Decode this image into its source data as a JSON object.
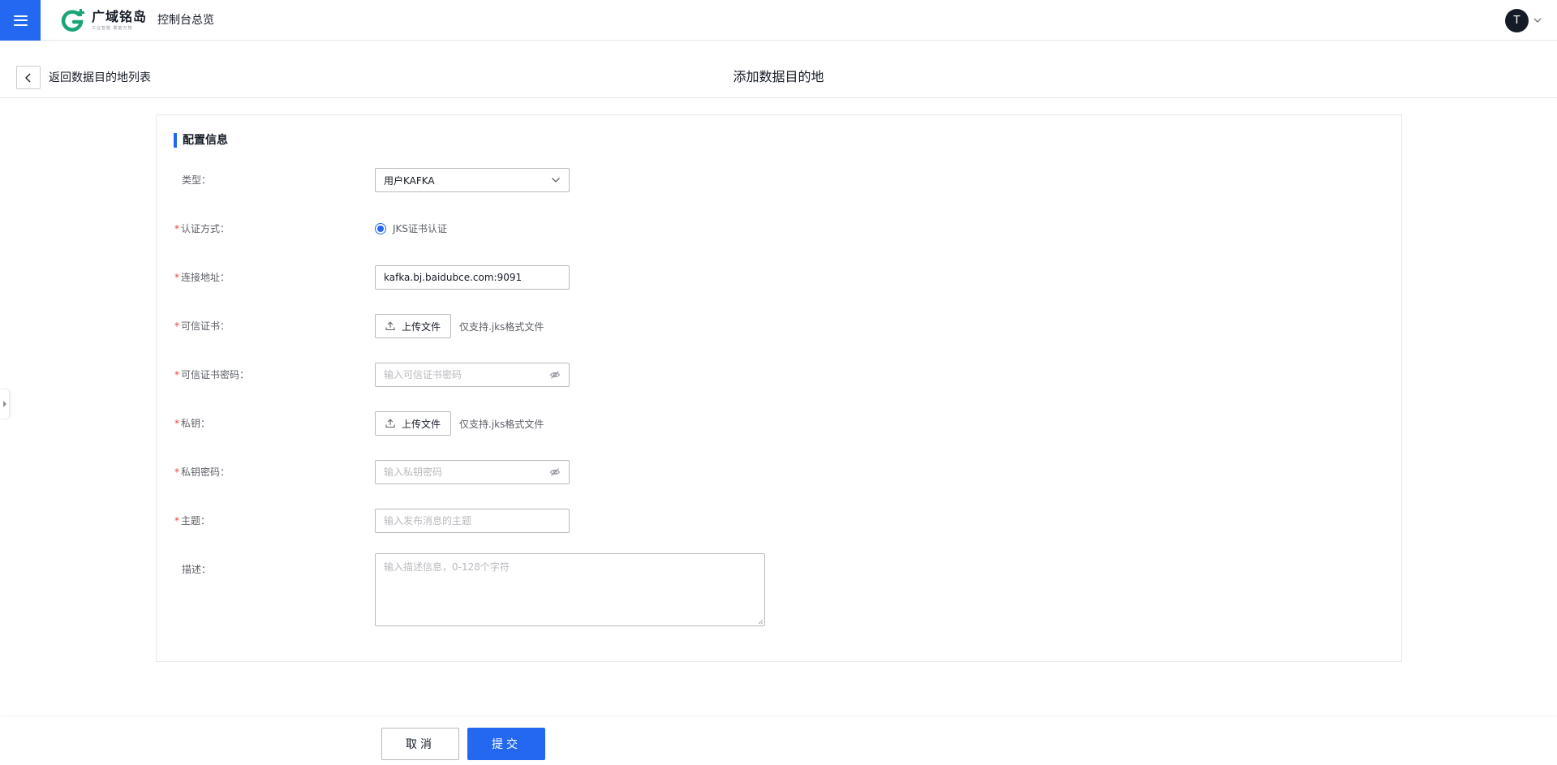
{
  "header": {
    "brand_name": "广域铭岛",
    "brand_slogan": "工业智能 赋能万物",
    "console_title": "控制台总览",
    "avatar_initial": "T",
    "brand_color": "#2468f2"
  },
  "subheader": {
    "back_label": "返回数据目的地列表",
    "page_title": "添加数据目的地"
  },
  "form": {
    "section_title": "配置信息",
    "type": {
      "label": "类型：",
      "value": "用户KAFKA"
    },
    "auth": {
      "label": "认证方式：",
      "option": "JKS证书认证",
      "selected": true
    },
    "address": {
      "label": "连接地址：",
      "value": "kafka.bj.baidubce.com:9091"
    },
    "trust_cert": {
      "label": "可信证书：",
      "button": "上传文件",
      "hint": "仅支持.jks格式文件"
    },
    "trust_cert_password": {
      "label": "可信证书密码：",
      "placeholder": "输入可信证书密码"
    },
    "private_key": {
      "label": "私钥：",
      "button": "上传文件",
      "hint": "仅支持.jks格式文件"
    },
    "private_key_password": {
      "label": "私钥密码：",
      "placeholder": "输入私钥密码"
    },
    "topic": {
      "label": "主题：",
      "placeholder": "输入发布消息的主题"
    },
    "description": {
      "label": "描述：",
      "placeholder": "输入描述信息，0-128个字符"
    }
  },
  "footer": {
    "cancel_label": "取消",
    "submit_label": "提交"
  },
  "icons": [
    "menu-icon",
    "logo-icon",
    "chevron-down-icon",
    "back-arrow-icon",
    "upload-icon",
    "eye-off-icon",
    "collapse-arrow-icon"
  ]
}
